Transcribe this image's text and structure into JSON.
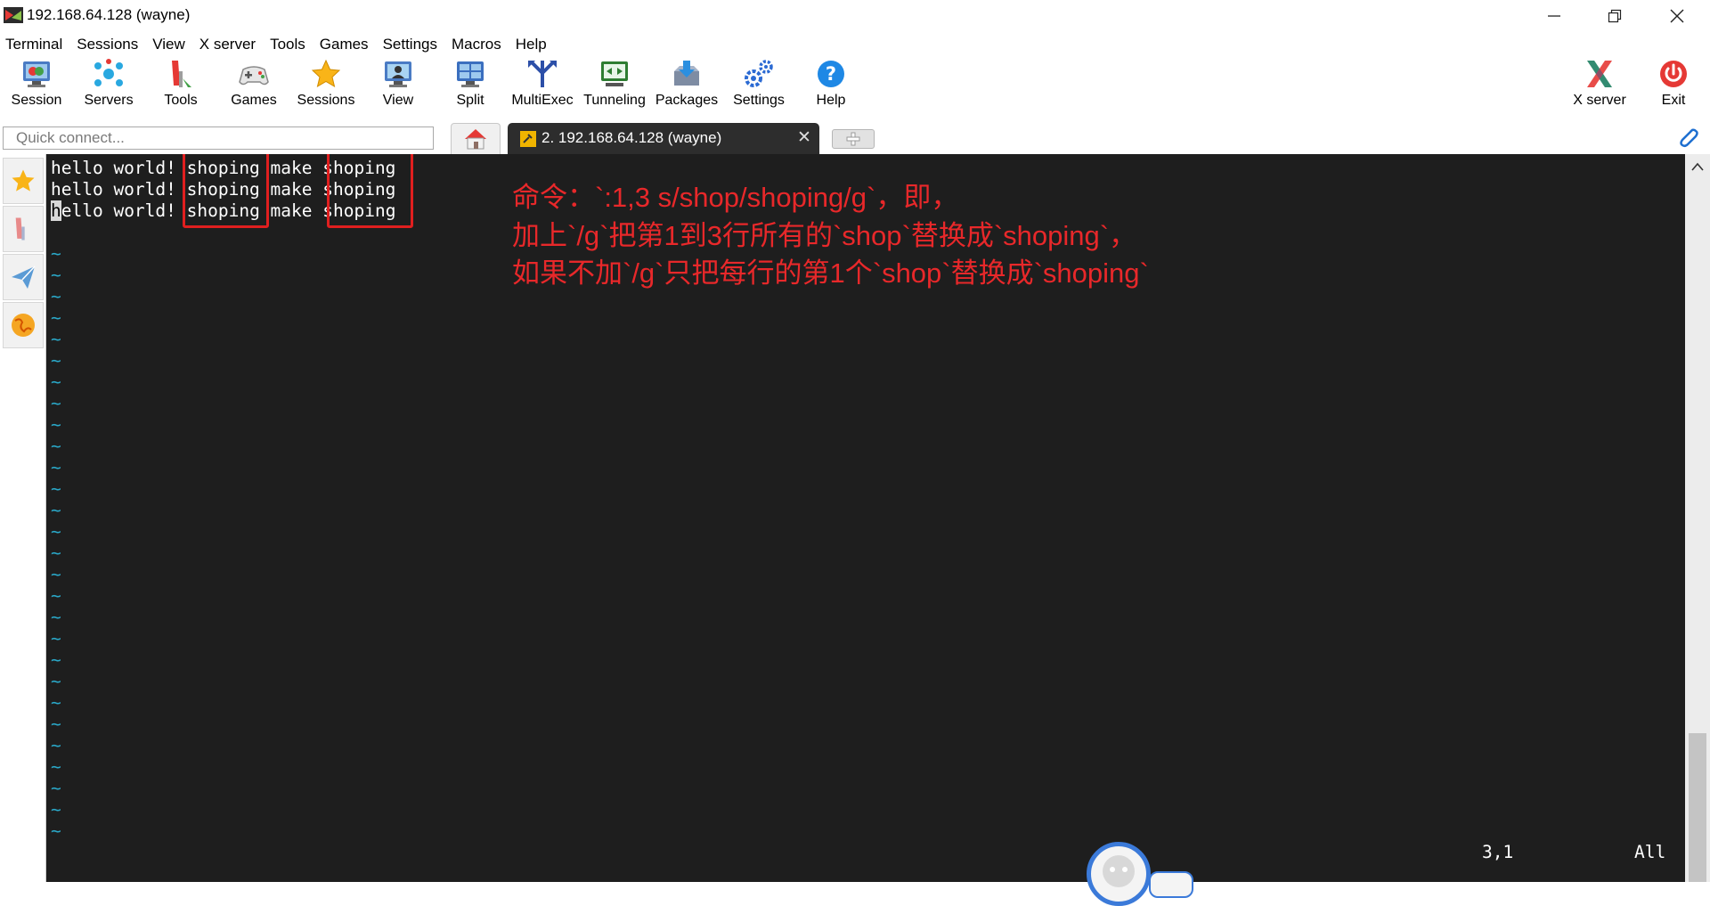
{
  "window": {
    "title": "192.168.64.128 (wayne)"
  },
  "menu": [
    "Terminal",
    "Sessions",
    "View",
    "X server",
    "Tools",
    "Games",
    "Settings",
    "Macros",
    "Help"
  ],
  "toolbar": {
    "session": "Session",
    "servers": "Servers",
    "tools": "Tools",
    "games": "Games",
    "sessions": "Sessions",
    "view": "View",
    "split": "Split",
    "multiexec": "MultiExec",
    "tunneling": "Tunneling",
    "packages": "Packages",
    "settings": "Settings",
    "help": "Help",
    "xserver": "X server",
    "exit": "Exit"
  },
  "quick_connect": {
    "placeholder": "Quick connect..."
  },
  "tabs": {
    "active_label": "2. 192.168.64.128 (wayne)"
  },
  "terminal": {
    "lines": [
      "hello world! shoping make shoping",
      "hello world! shoping make shoping",
      "hello world! shoping make shoping"
    ],
    "cursor_char": "h",
    "line3_rest": "ello world! shoping make shoping",
    "tilde": "~",
    "status_position": "3,1",
    "status_view": "All"
  },
  "annotation": {
    "line1": "命令：`:1,3 s/shop/shoping/g`，即，",
    "line2": "加上`/g`把第1到3行所有的`shop`替换成`shoping`，",
    "line3": "如果不加`/g`只把每行的第1个`shop`替换成`shoping`",
    "color": "#e8282a"
  },
  "colors": {
    "terminal_bg": "#1e1e1e",
    "tilde": "#2aa8c8",
    "highlight_box": "#e01f1f"
  }
}
